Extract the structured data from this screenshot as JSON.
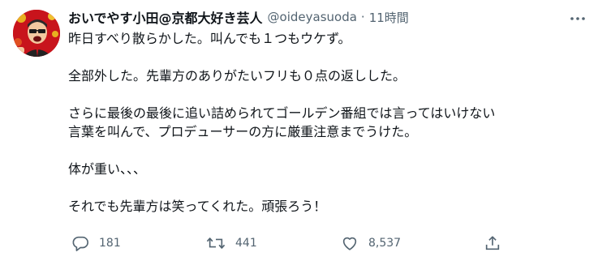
{
  "tweet": {
    "display_name": "おいでやす小田@京都大好き芸人",
    "handle": "@oideyasuoda",
    "separator": "·",
    "time": "11時間",
    "lines": [
      "昨日すべり散らかした。叫んでも１つもウケず。",
      "",
      "全部外した。先輩方のありがたいフリも０点の返しした。",
      "",
      "さらに最後の最後に追い詰められてゴールデン番組では言ってはいけない",
      "言葉を叫んで、プロデューサーの方に厳重注意までうけた。",
      "",
      "体が重い、、、",
      "",
      "それでも先輩方は笑ってくれた。頑張ろう！"
    ],
    "actions": {
      "reply_count": "181",
      "retweet_count": "441",
      "like_count": "8,537"
    },
    "icons": {
      "avatar": "user-avatar-photo",
      "more": "more-icon",
      "reply": "reply-icon",
      "retweet": "retweet-icon",
      "like": "heart-icon",
      "share": "share-icon"
    },
    "colors": {
      "text": "#0f1419",
      "secondary": "#536471",
      "avatar_bg": "#c8141c"
    }
  }
}
